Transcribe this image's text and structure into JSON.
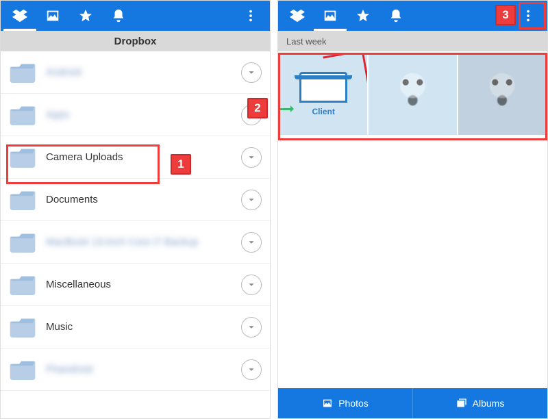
{
  "colors": {
    "accent": "#1478e0",
    "badge": "#ee3c3c"
  },
  "nav_icons": [
    "dropbox-icon",
    "photos-icon",
    "star-icon",
    "bell-icon",
    "more-icon"
  ],
  "left": {
    "header": "Dropbox",
    "active_tab_index": 0,
    "folders": [
      {
        "name": "Android",
        "blurred": true
      },
      {
        "name": "Apps",
        "blurred": true
      },
      {
        "name": "Camera Uploads",
        "blurred": false
      },
      {
        "name": "Documents",
        "blurred": false
      },
      {
        "name": "MacBook 13-inch Core i7 Backup",
        "blurred": true
      },
      {
        "name": "Miscellaneous",
        "blurred": false
      },
      {
        "name": "Music",
        "blurred": false
      },
      {
        "name": "Phandroid",
        "blurred": true
      }
    ]
  },
  "right": {
    "active_tab_index": 1,
    "group_header": "Last week",
    "client_label": "Client",
    "bottom_tabs": {
      "photos": "Photos",
      "albums": "Albums"
    }
  },
  "annotations": {
    "badge1": "1",
    "badge2": "2",
    "badge3": "3"
  }
}
